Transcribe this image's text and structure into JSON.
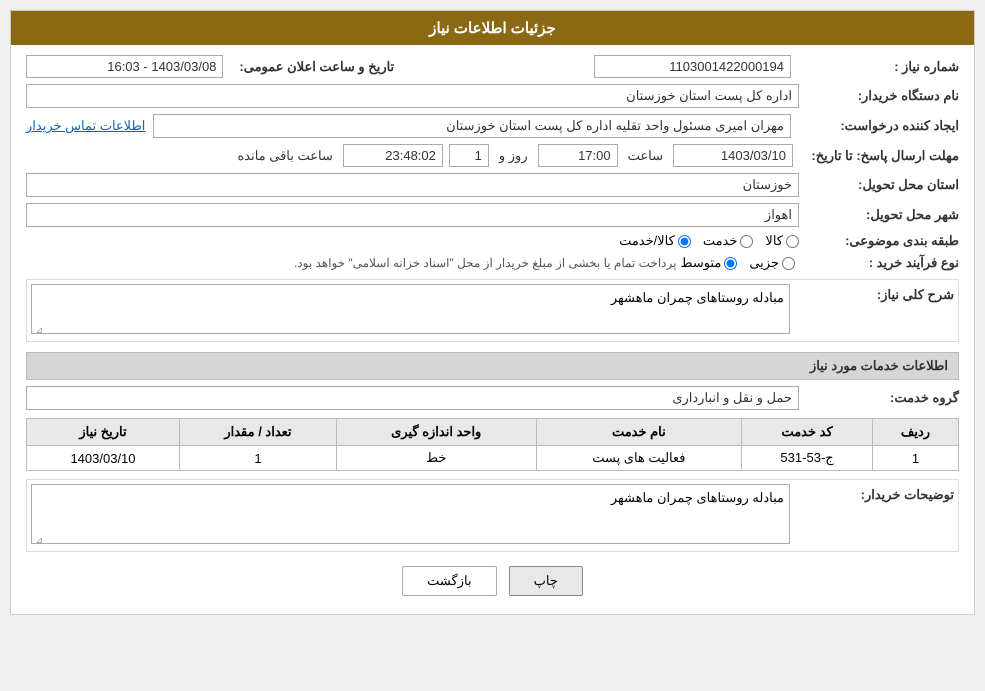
{
  "header": {
    "title": "جزئیات اطلاعات نیاز"
  },
  "fields": {
    "shomara_niaz_label": "شماره نیاز :",
    "shomara_niaz_value": "1103001422000194",
    "nam_dastgah_label": "نام دستگاه خریدار:",
    "nam_dastgah_value": "اداره کل پست استان خوزستان",
    "ijad_konande_label": "ایجاد کننده درخواست:",
    "ijad_konande_value": "مهران امیری مسئول واحد تقلیه اداره کل پست استان خوزستان",
    "etela_tamas_label": "اطلاعات تماس خریدار",
    "mohlat_label": "مهلت ارسال پاسخ: تا تاریخ:",
    "mohlat_date": "1403/03/10",
    "mohlat_saat_label": "ساعت",
    "mohlat_saat_value": "17:00",
    "mohlat_rooz_label": "روز و",
    "mohlat_rooz_value": "1",
    "mohlat_baqi_label": "ساعت باقی مانده",
    "mohlat_baqi_value": "23:48:02",
    "ostan_label": "استان محل تحویل:",
    "ostan_value": "خوزستان",
    "shahr_label": "شهر محل تحویل:",
    "shahr_value": "اهواز",
    "tabaqe_label": "طبقه بندی موضوعی:",
    "tabaqe_options": [
      "کالا",
      "خدمت",
      "کالا/خدمت"
    ],
    "tabaqe_selected": "کالا",
    "nooe_farayand_label": "نوع فرآیند خرید :",
    "nooe_farayand_options": [
      "جزیی",
      "متوسط"
    ],
    "nooe_farayand_selected": "متوسط",
    "nooe_farayand_desc": "پرداخت تمام یا بخشی از مبلغ خریدار از محل \"اسناد خزانه اسلامی\" خواهد بود.",
    "sharh_niaz_label": "شرح کلی نیاز:",
    "sharh_niaz_value": "مبادله روستاهای چمران ماهشهر",
    "service_section_title": "اطلاعات خدمات مورد نیاز",
    "grooh_khedmat_label": "گروه خدمت:",
    "grooh_khedmat_value": "حمل و نقل و انبارداری",
    "table": {
      "headers": [
        "ردیف",
        "کد خدمت",
        "نام خدمت",
        "واحد اندازه گیری",
        "تعداد / مقدار",
        "تاریخ نیاز"
      ],
      "rows": [
        {
          "radif": "1",
          "kod_khedmat": "ج-53-531",
          "nam_khedmat": "فعالیت های پست",
          "vahed": "خط",
          "tedad": "1",
          "tarikh": "1403/03/10"
        }
      ]
    },
    "tozihat_label": "توضیحات خریدار:",
    "tozihat_value": "مبادله روستاهای چمران ماهشهر"
  },
  "buttons": {
    "print_label": "چاپ",
    "back_label": "بازگشت"
  },
  "announce_date_label": "تاریخ و ساعت اعلان عمومی:",
  "announce_date_value": "1403/03/08 - 16:03"
}
